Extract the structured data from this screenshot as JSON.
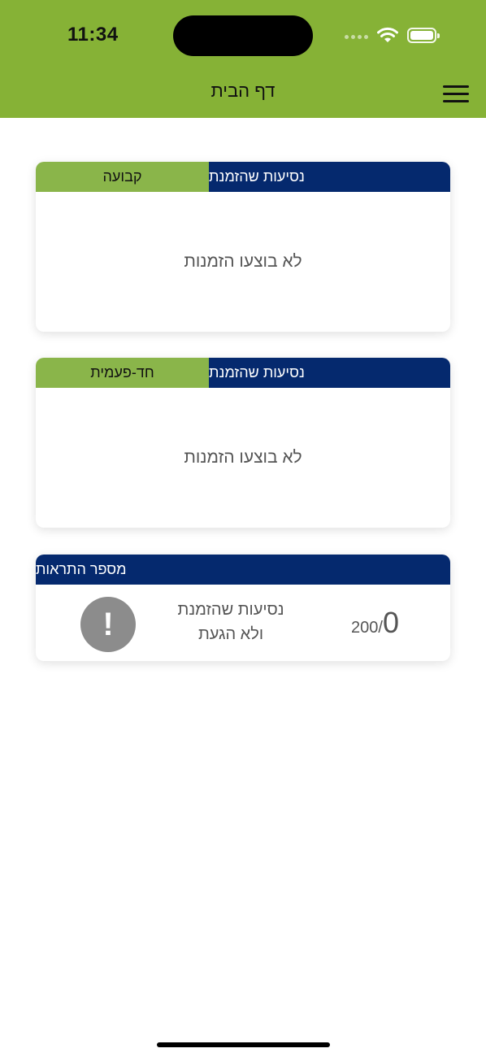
{
  "status_bar": {
    "time": "11:34"
  },
  "header": {
    "title": "דף הבית"
  },
  "cards": [
    {
      "title": "נסיעות שהזמנת",
      "tag": "קבועה",
      "empty_text": "לא בוצעו הזמנות"
    },
    {
      "title": "נסיעות שהזמנת",
      "tag": "חד-פעמית",
      "empty_text": "לא בוצעו הזמנות"
    }
  ],
  "alerts_card": {
    "title": "מספר התראות",
    "description_line1": "נסיעות שהזמנת",
    "description_line2": "ולא הגעת",
    "count": "0",
    "limit": "200/"
  },
  "colors": {
    "header_green": "#86b236",
    "tag_green": "#8ab54a",
    "navy": "#05296e"
  },
  "icons": [
    "wifi-icon",
    "battery-icon",
    "menu-icon",
    "exclamation-icon"
  ]
}
